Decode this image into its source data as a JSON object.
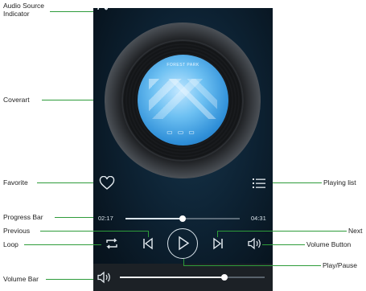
{
  "player": {
    "disc_label": "FOREST PARK",
    "elapsed_time": "02:17",
    "total_time": "04:31",
    "progress": 0.5,
    "volume": 0.72,
    "colors": {
      "accent_line": "#2e9c3a",
      "background": "#0d2233",
      "art_blue": "#2f8fd8"
    }
  },
  "callouts": {
    "audio_source": "Audio Source",
    "audio_source_line2": "Indicator",
    "coverart": "Coverart",
    "favorite": "Favorite",
    "progress_bar": "Progress Bar",
    "previous": "Previous",
    "loop": "Loop",
    "volume_bar": "Volume Bar",
    "playing_list": "Playing list",
    "next": "Next",
    "volume_button": "Volume Button",
    "play_pause": "Play/Pause"
  },
  "icons": [
    "audio-source-icon",
    "heart-icon",
    "playlist-icon",
    "loop-icon",
    "previous-icon",
    "play-icon",
    "next-icon",
    "volume-icon"
  ]
}
